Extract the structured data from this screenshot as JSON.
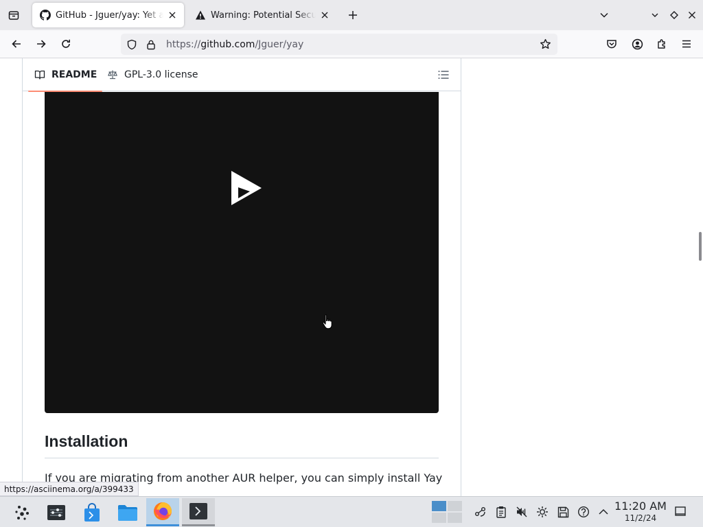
{
  "browser": {
    "tabs": [
      {
        "title": "GitHub - Jguer/yay: Yet another Yogurt - An AUR Helper written in Go",
        "favicon": "github-icon",
        "active": true
      },
      {
        "title": "Warning: Potential Security Risk Ahead",
        "favicon": "warning-icon",
        "active": false
      }
    ],
    "url": {
      "prefix": "https://",
      "host": "github.com",
      "path": "/Jguer/yay"
    },
    "status_url": "https://asciinema.org/a/399433"
  },
  "readme": {
    "tabs": [
      {
        "label": "README",
        "icon": "book-icon",
        "selected": true
      },
      {
        "label": "GPL-3.0 license",
        "icon": "law-icon",
        "selected": false
      }
    ],
    "video_logo": "asciinema-play-icon",
    "heading": "Installation",
    "paragraph": "If you are migrating from another AUR helper, you can simply install Yay"
  },
  "taskbar": {
    "apps": [
      "application-launcher-icon",
      "system-settings-icon",
      "discover-store-icon",
      "file-manager-icon",
      "firefox-icon",
      "terminal-icon"
    ],
    "clock": {
      "time": "11:20 AM",
      "date": "11/2/24"
    }
  },
  "colors": {
    "tab_underline": "#fd8c73",
    "video_bg": "#121212",
    "taskbar_accent": "#3d8fd9"
  }
}
